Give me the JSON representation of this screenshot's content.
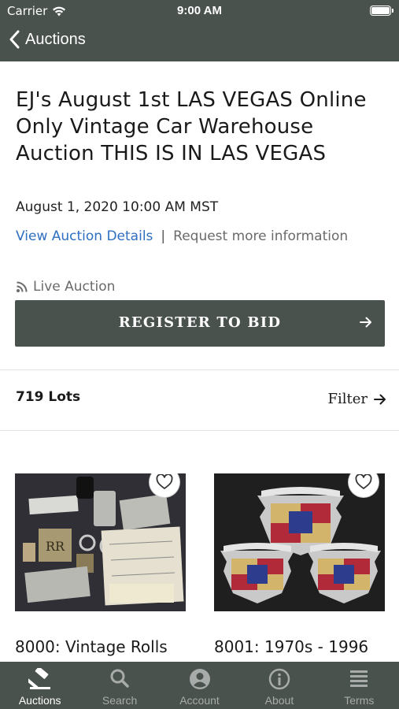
{
  "status_bar": {
    "carrier": "Carrier",
    "time": "9:00 AM"
  },
  "nav": {
    "back_label": "Auctions"
  },
  "auction": {
    "title": "EJ's August 1st LAS VEGAS Online Only Vintage Car Warehouse Auction THIS IS IN LAS VEGAS",
    "date": "August 1, 2020 10:00 AM MST",
    "view_details": "View Auction Details",
    "separator": "|",
    "request_info": "Request more information",
    "live_label": "Live Auction",
    "register_label": "REGISTER TO BID"
  },
  "lots": {
    "count_label": "719 Lots",
    "filter_label": "Filter",
    "items": [
      {
        "title": "8000: Vintage Rolls"
      },
      {
        "title": "8001: 1970s - 1996"
      }
    ]
  },
  "tabs": [
    {
      "label": "Auctions",
      "icon": "gavel-icon",
      "active": true
    },
    {
      "label": "Search",
      "icon": "search-icon",
      "active": false
    },
    {
      "label": "Account",
      "icon": "account-icon",
      "active": false
    },
    {
      "label": "About",
      "icon": "info-icon",
      "active": false
    },
    {
      "label": "Terms",
      "icon": "terms-icon",
      "active": false
    }
  ],
  "colors": {
    "brand": "#4a524e",
    "link": "#2f6fc1",
    "tab_inactive": "#a7aba9"
  }
}
